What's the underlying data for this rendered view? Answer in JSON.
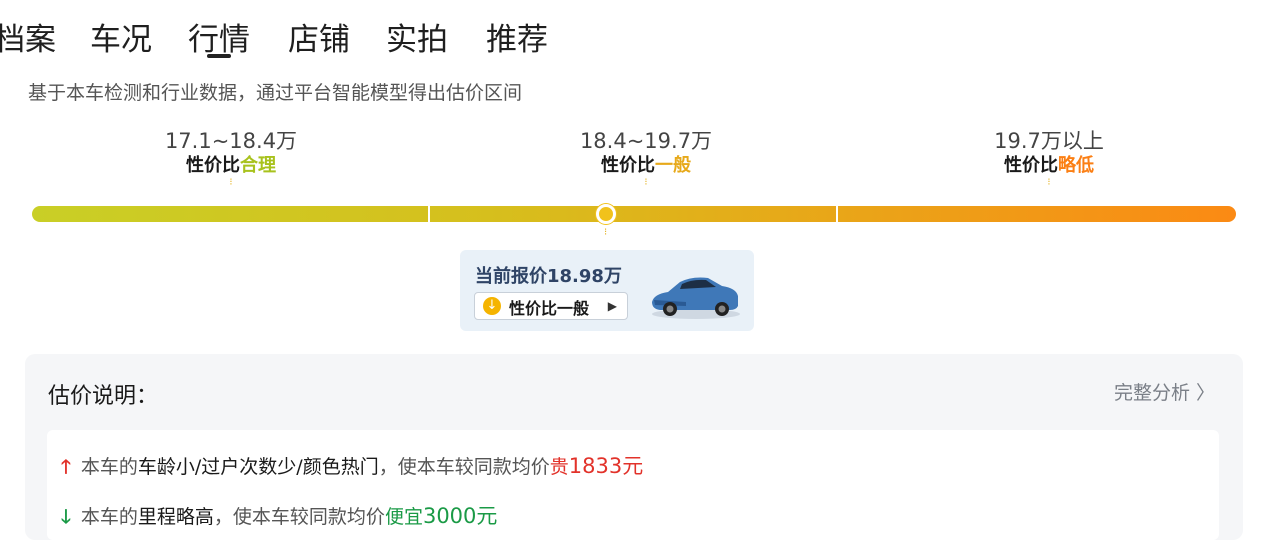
{
  "tabs": [
    {
      "label": "档案"
    },
    {
      "label": "车况"
    },
    {
      "label": "行情"
    },
    {
      "label": "店铺"
    },
    {
      "label": "实拍"
    },
    {
      "label": "推荐"
    }
  ],
  "active_tab": "行情",
  "subtitle": "基于本车检测和行业数据，通过平台智能模型得出估价区间",
  "segments": [
    {
      "range": "17.1~18.4万",
      "prefix": "性价比",
      "rating": "合理",
      "color": "#a8c21d"
    },
    {
      "range": "18.4~19.7万",
      "prefix": "性价比",
      "rating": "一般",
      "color": "#e7a91a"
    },
    {
      "range": "19.7万以上",
      "prefix": "性价比",
      "rating": "略低",
      "color": "#fb7f14"
    }
  ],
  "quote": {
    "price_text": "当前报价18.98万",
    "badge_text": "性价比一般",
    "badge_icon": "down-circle-icon",
    "arrow_icon": "triangle-right-icon"
  },
  "explain": {
    "title": "估价说明：",
    "full_link": "完整分析 〉",
    "reasons": [
      {
        "direction": "up",
        "prefix": "本车的",
        "factor": "车龄小/过户次数少/颜色热门",
        "middle": "，使本车较同款均价",
        "verdict": "贵",
        "amount": "1833元"
      },
      {
        "direction": "down",
        "prefix": "本车的",
        "factor": "里程略高",
        "middle": "，使本车较同款均价",
        "verdict": "便宜",
        "amount": "3000元"
      }
    ]
  },
  "colors": {
    "accent_yellow": "#f1c21b",
    "price_up": "#e2322a",
    "price_down": "#1a9a46"
  }
}
